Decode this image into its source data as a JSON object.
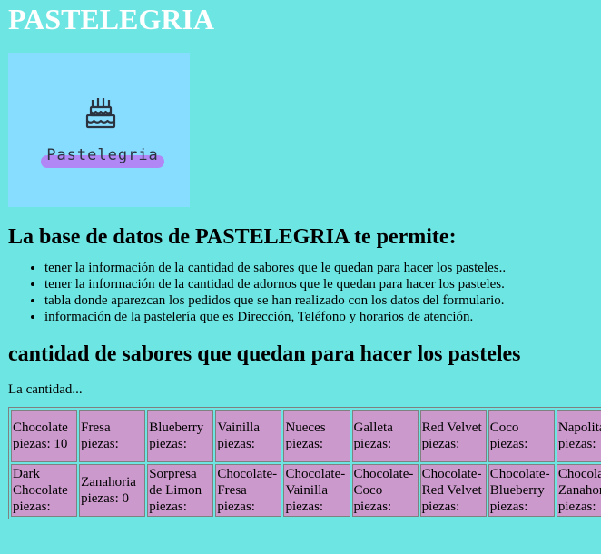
{
  "title": "PASTELEGRIA",
  "logo": {
    "text": "Pastelegria",
    "accent": "#b187f5",
    "background": "#87ddff",
    "icon": "cake-icon"
  },
  "intro_heading": "La base de datos de PASTELEGRIA te permite:",
  "features": [
    "tener la información de la cantidad de sabores que le quedan para hacer los pasteles..",
    "tener la información de la cantidad de adornos que le quedan para hacer los pasteles.",
    "tabla donde aparezcan los pedidos que se han realizado con los datos del formulario.",
    "información de la pastelería que es Dirección, Teléfono y horarios de atención."
  ],
  "flavors_heading": "cantidad de sabores que quedan para hacer los pasteles",
  "quantity_text": "La cantidad...",
  "table": {
    "rows": [
      [
        {
          "name": "Chocolate",
          "count": "piezas: 10"
        },
        {
          "name": "Fresa",
          "count": "piezas:"
        },
        {
          "name": "Blueberry",
          "count": "piezas:"
        },
        {
          "name": "Vainilla",
          "count": "piezas:"
        },
        {
          "name": "Nueces",
          "count": "piezas:"
        },
        {
          "name": "Galleta",
          "count": "piezas:"
        },
        {
          "name": "Red Velvet",
          "count": "piezas:"
        },
        {
          "name": "Coco",
          "count": "piezas:"
        },
        {
          "name": "Napolitano",
          "count": "piezas:"
        }
      ],
      [
        {
          "name": "Dark Chocolate",
          "count": "piezas:"
        },
        {
          "name": "Zanahoria",
          "count": "piezas: 0"
        },
        {
          "name": "Sorpresa de Limon",
          "count": "piezas:"
        },
        {
          "name": "Chocolate-Fresa",
          "count": "piezas:"
        },
        {
          "name": "Chocolate-Vainilla",
          "count": "piezas:"
        },
        {
          "name": "Chocolate-Coco",
          "count": "piezas:"
        },
        {
          "name": "Chocolate-Red Velvet",
          "count": "piezas:"
        },
        {
          "name": "Chocolate-Blueberry",
          "count": "piezas:"
        },
        {
          "name": "Chocolate-Zanahoria",
          "count": "piezas:"
        }
      ]
    ]
  }
}
